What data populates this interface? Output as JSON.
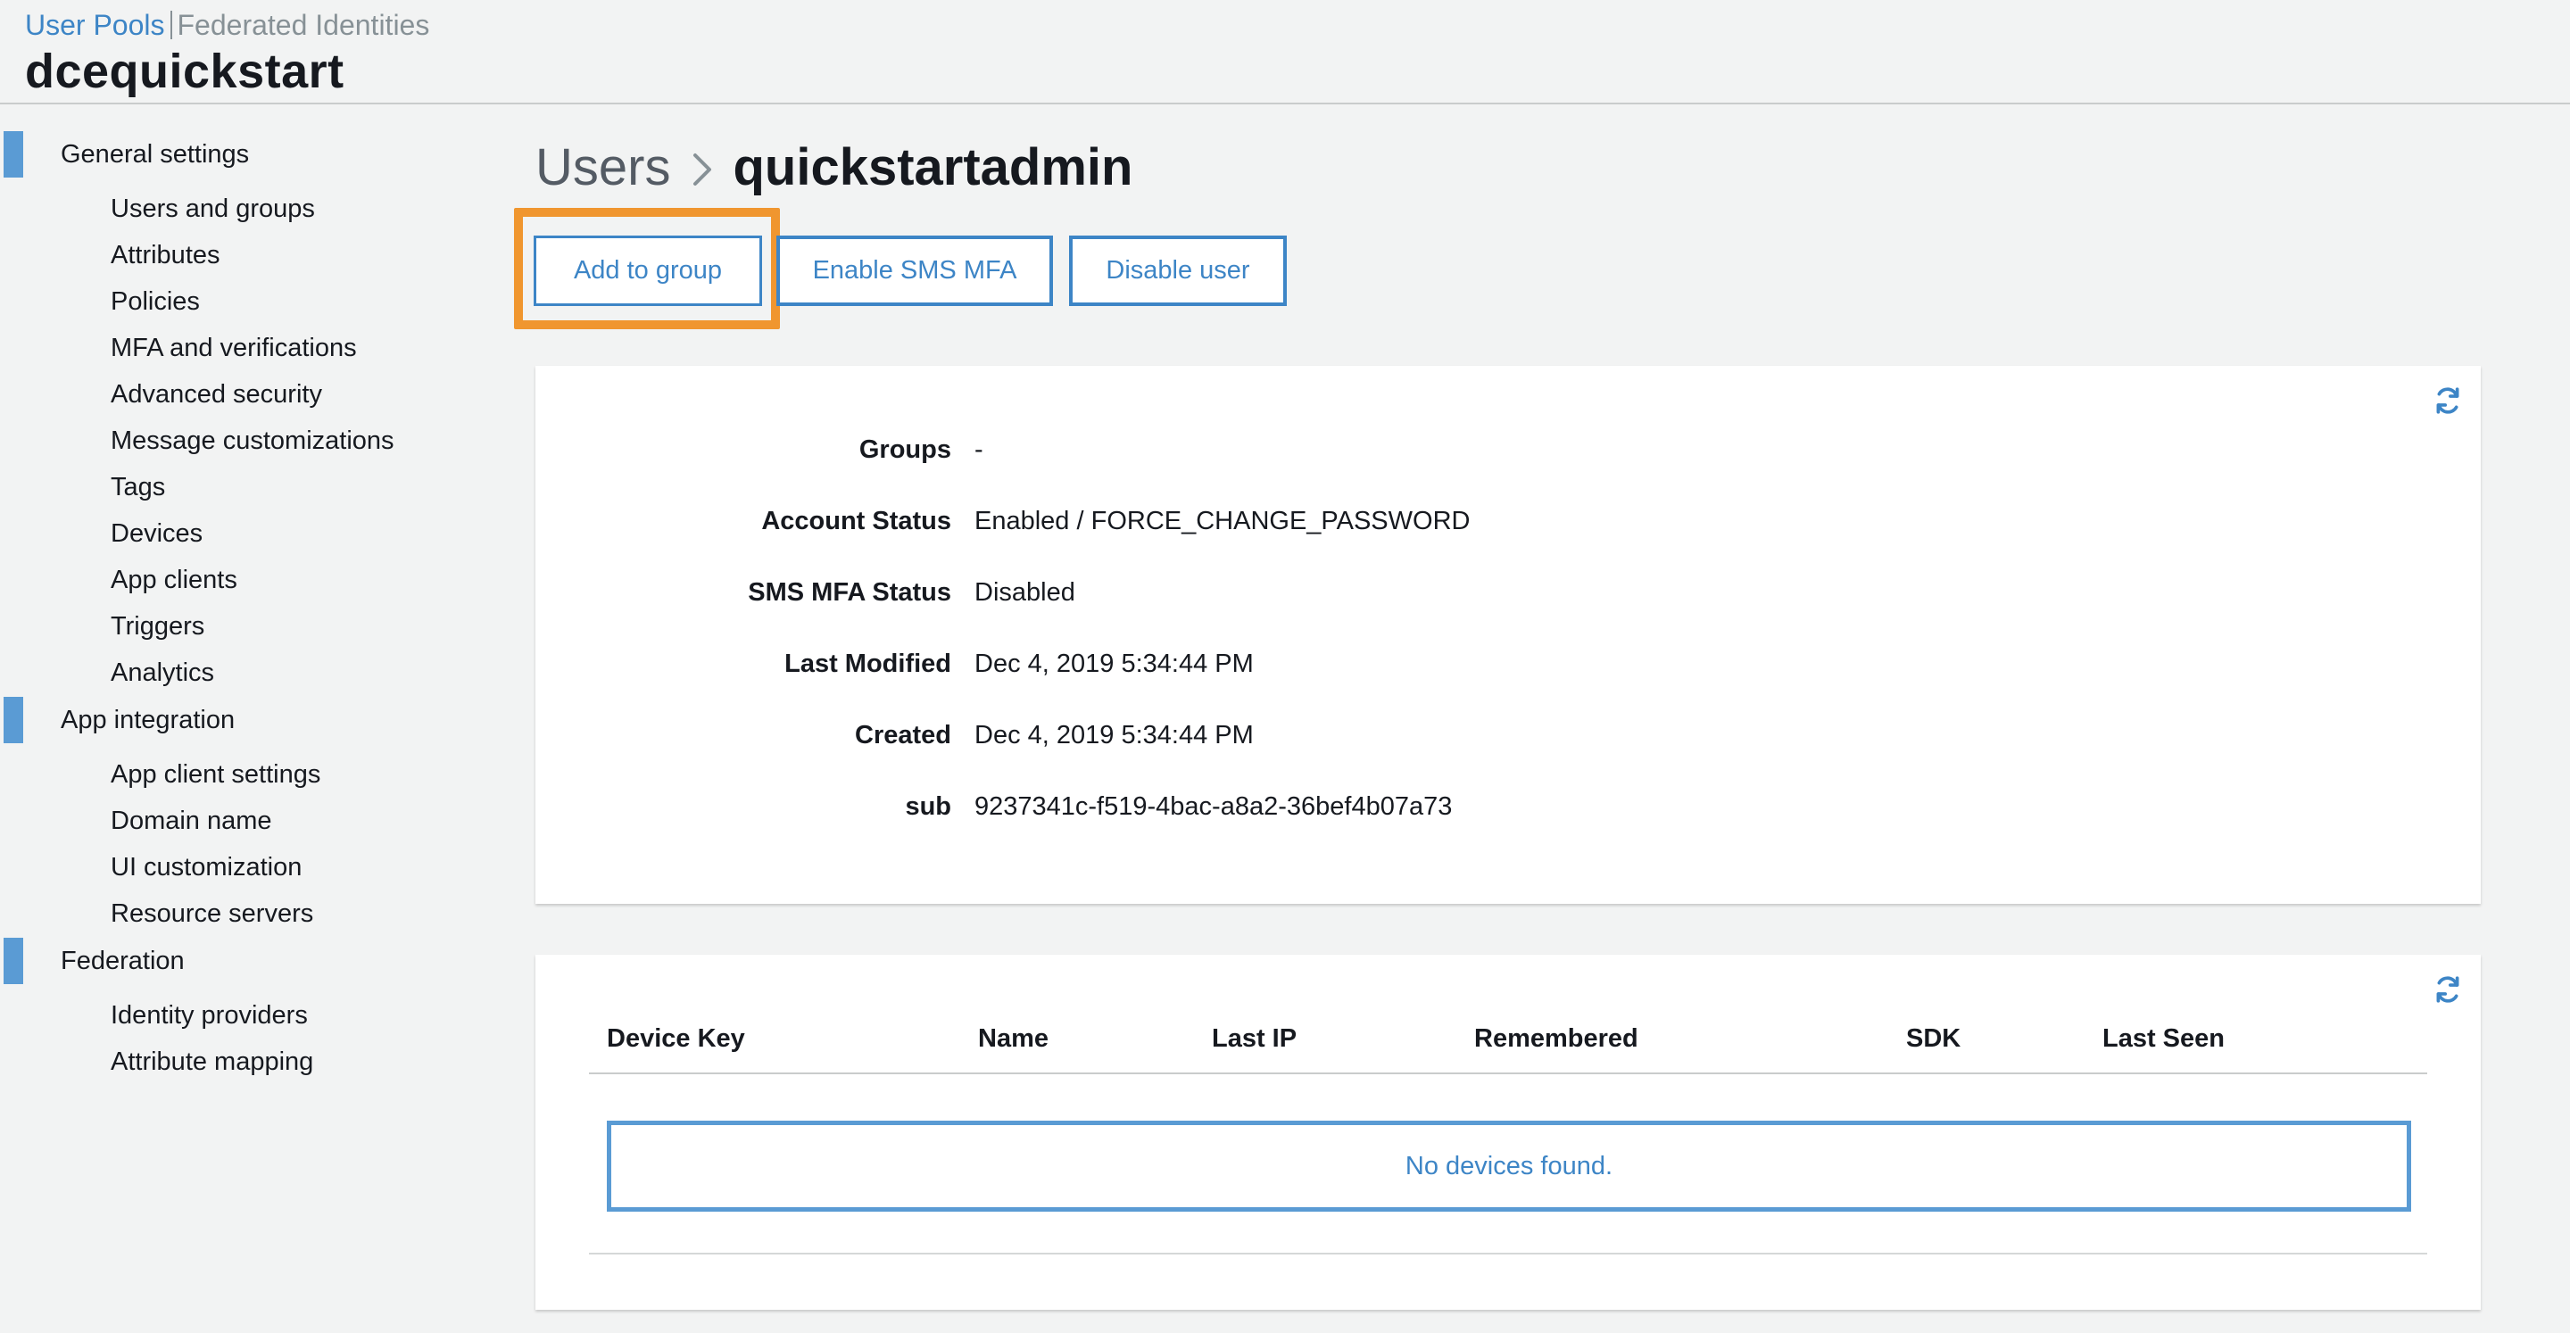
{
  "header": {
    "tab_user_pools": "User Pools",
    "tab_federated": "Federated Identities",
    "pool_name": "dcequickstart"
  },
  "sidebar": {
    "sections": [
      {
        "label": "General settings",
        "items": [
          "Users and groups",
          "Attributes",
          "Policies",
          "MFA and verifications",
          "Advanced security",
          "Message customizations",
          "Tags",
          "Devices",
          "App clients",
          "Triggers",
          "Analytics"
        ]
      },
      {
        "label": "App integration",
        "items": [
          "App client settings",
          "Domain name",
          "UI customization",
          "Resource servers"
        ]
      },
      {
        "label": "Federation",
        "items": [
          "Identity providers",
          "Attribute mapping"
        ]
      }
    ]
  },
  "breadcrumb": {
    "parent": "Users",
    "current": "quickstartadmin"
  },
  "actions": {
    "add_to_group": "Add to group",
    "enable_sms_mfa": "Enable SMS MFA",
    "disable_user": "Disable user"
  },
  "details": [
    {
      "label": "Groups",
      "value": "-"
    },
    {
      "label": "Account Status",
      "value": "Enabled / FORCE_CHANGE_PASSWORD"
    },
    {
      "label": "SMS MFA Status",
      "value": "Disabled"
    },
    {
      "label": "Last Modified",
      "value": "Dec 4, 2019 5:34:44 PM"
    },
    {
      "label": "Created",
      "value": "Dec 4, 2019 5:34:44 PM"
    },
    {
      "label": "sub",
      "value": "9237341c-f519-4bac-a8a2-36bef4b07a73"
    }
  ],
  "devices": {
    "columns": [
      "Device Key",
      "Name",
      "Last IP",
      "Remembered",
      "SDK",
      "Last Seen"
    ],
    "empty_message": "No devices found."
  },
  "colors": {
    "accent": "#3d85c6",
    "highlight": "#f0962f",
    "section_bar": "#5a9bd4"
  },
  "icons": {
    "refresh": "refresh-icon",
    "breadcrumb_separator": "chevron-right-icon"
  }
}
